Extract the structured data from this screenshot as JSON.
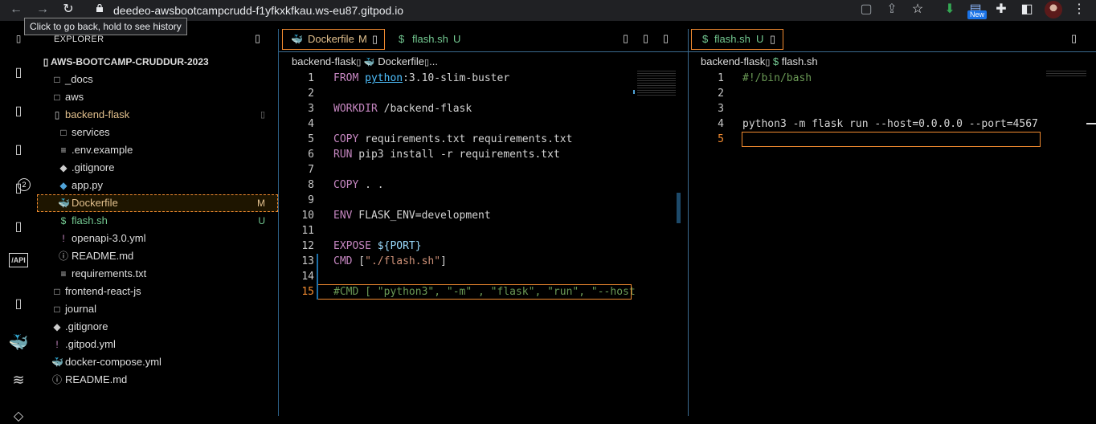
{
  "browser": {
    "url": "deedeo-awsbootcampcrudd-f1yfkxkfkau.ws-eu87.gitpod.io",
    "tooltip": "Click to go back, hold to see history",
    "new_badge": "New",
    "icons": [
      "back-arrow-icon",
      "forward-arrow-icon",
      "reload-icon",
      "lock-icon",
      "tab-search-icon",
      "share-icon",
      "star-icon",
      "download-icon",
      "extension-icon",
      "puzzle-icon",
      "sidebar-icon",
      "avatar",
      "more-icon"
    ]
  },
  "activity": {
    "source_control_badge": "2",
    "api_label": "/API"
  },
  "explorer": {
    "title": "EXPLORER",
    "root": "AWS-BOOTCAMP-CRUDDUR-2023",
    "items": [
      {
        "label": "_docs",
        "icon": "□",
        "color": "#dddddd"
      },
      {
        "label": "aws",
        "icon": "□",
        "color": "#dddddd"
      },
      {
        "label": "backend-flask",
        "icon": "▯",
        "color": "#e2c08d"
      },
      {
        "label": "services",
        "icon": "□",
        "color": "#dddddd"
      },
      {
        "label": ".env.example",
        "icon": "≡",
        "color": "#dddddd"
      },
      {
        "label": ".gitignore",
        "icon": "◆",
        "color": "#dddddd"
      },
      {
        "label": "app.py",
        "icon": "◆",
        "color": "#dddddd"
      },
      {
        "label": "Dockerfile",
        "icon": "🐳",
        "color": "#e2c08d",
        "badge": "M"
      },
      {
        "label": "flash.sh",
        "icon": "$",
        "color": "#73c991",
        "badge": "U"
      },
      {
        "label": "openapi-3.0.yml",
        "icon": "!",
        "color": "#dddddd"
      },
      {
        "label": "README.md",
        "icon": "ⓘ",
        "color": "#dddddd"
      },
      {
        "label": "requirements.txt",
        "icon": "≡",
        "color": "#dddddd"
      },
      {
        "label": "frontend-react-js",
        "icon": "□",
        "color": "#dddddd"
      },
      {
        "label": "journal",
        "icon": "□",
        "color": "#dddddd"
      },
      {
        "label": ".gitignore",
        "icon": "◆",
        "color": "#dddddd"
      },
      {
        "label": ".gitpod.yml",
        "icon": "!",
        "color": "#dddddd"
      },
      {
        "label": "docker-compose.yml",
        "icon": "🐳",
        "color": "#dddddd"
      },
      {
        "label": "README.md",
        "icon": "ⓘ",
        "color": "#dddddd"
      }
    ]
  },
  "left_editor": {
    "tabs": [
      {
        "label": "Dockerfile",
        "status": "M"
      },
      {
        "label": "flash.sh",
        "status": "U"
      }
    ],
    "breadcrumb": {
      "folder": "backend-flask",
      "file": "Dockerfile",
      "tail": "..."
    },
    "lines": [
      [
        [
          "kw",
          "FROM"
        ],
        [
          "pl",
          " "
        ],
        [
          "ul",
          "python"
        ],
        [
          "pl",
          ":3.10-slim-buster"
        ]
      ],
      [],
      [
        [
          "kw",
          "WORKDIR"
        ],
        [
          "pl",
          " /backend-flask"
        ]
      ],
      [],
      [
        [
          "kw",
          "COPY"
        ],
        [
          "pl",
          " requirements.txt requirements.txt"
        ]
      ],
      [
        [
          "kw",
          "RUN"
        ],
        [
          "pl",
          " pip3 install -r requirements.txt"
        ]
      ],
      [],
      [
        [
          "kw",
          "COPY"
        ],
        [
          "pl",
          " . ."
        ]
      ],
      [],
      [
        [
          "kw",
          "ENV"
        ],
        [
          "pl",
          " FLASK_ENV=development"
        ]
      ],
      [],
      [
        [
          "kw",
          "EXPOSE"
        ],
        [
          "pl",
          " "
        ],
        [
          "var",
          "${PORT}"
        ]
      ],
      [
        [
          "kw",
          "CMD"
        ],
        [
          "pl",
          " ["
        ],
        [
          "str",
          "\"./flash.sh\""
        ],
        [
          "pl",
          "]"
        ]
      ],
      [],
      [
        [
          "cm",
          "#CMD [ \"python3\", \"-m\" , \"flask\", \"run\", \"--host"
        ]
      ]
    ],
    "line_numbers": [
      "1",
      "2",
      "3",
      "4",
      "5",
      "6",
      "7",
      "8",
      "9",
      "10",
      "11",
      "12",
      "13",
      "14",
      "15"
    ]
  },
  "right_editor": {
    "tabs": [
      {
        "label": "flash.sh",
        "status": "U"
      }
    ],
    "breadcrumb": {
      "folder": "backend-flask",
      "file": "flash.sh"
    },
    "lines": [
      [
        [
          "cm",
          "#!/bin/bash"
        ]
      ],
      [],
      [],
      [
        [
          "pl",
          "python3 -m flask run --host=0.0.0.0 --port=4567"
        ]
      ],
      []
    ],
    "line_numbers": [
      "1",
      "2",
      "3",
      "4",
      "5"
    ]
  },
  "colors": {
    "accent_orange": "#f28b30",
    "untracked_green": "#73c991",
    "modified_amber": "#e2c08d",
    "border_blue": "#3b6a8f"
  }
}
